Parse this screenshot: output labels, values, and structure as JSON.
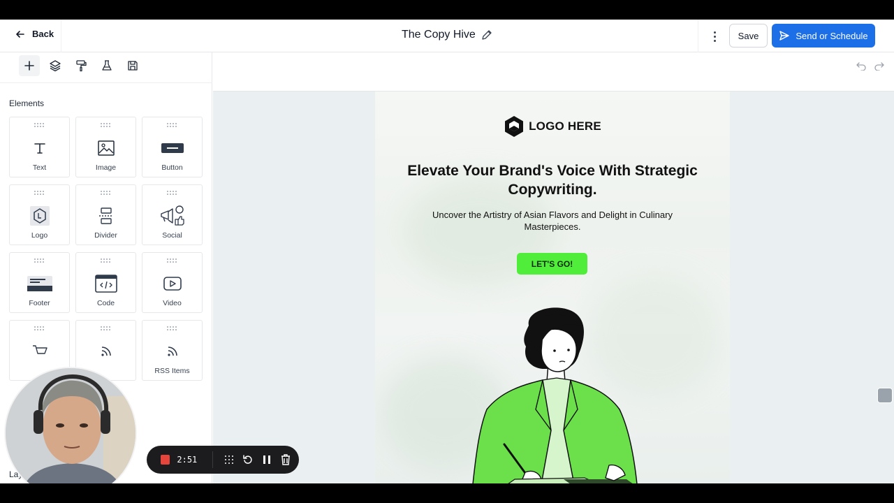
{
  "header": {
    "back_label": "Back",
    "title": "The Copy Hive",
    "save_label": "Save",
    "send_label": "Send or Schedule"
  },
  "sidebar": {
    "tools": [
      "plus-icon",
      "layers-icon",
      "paint-roller-icon",
      "flask-icon",
      "save-icon"
    ],
    "elements_label": "Elements",
    "elements": [
      {
        "label": "Text",
        "icon": "text-icon"
      },
      {
        "label": "Image",
        "icon": "image-icon"
      },
      {
        "label": "Button",
        "icon": "button-icon"
      },
      {
        "label": "Logo",
        "icon": "logo-icon"
      },
      {
        "label": "Divider",
        "icon": "divider-icon"
      },
      {
        "label": "Social",
        "icon": "social-icon"
      },
      {
        "label": "Footer",
        "icon": "footer-icon"
      },
      {
        "label": "Code",
        "icon": "code-icon"
      },
      {
        "label": "Video",
        "icon": "video-icon"
      },
      {
        "label": "",
        "icon": "cart-icon"
      },
      {
        "label": "",
        "icon": "rss-icon"
      },
      {
        "label": "RSS Items",
        "icon": "rss-icon"
      }
    ],
    "layouts_label": "Layouts"
  },
  "email": {
    "logo_text": "LOGO HERE",
    "headline": "Elevate Your Brand's Voice With Strategic Copywriting.",
    "subhead": "Uncover the Artistry of Asian Flavors and Delight in Culinary Masterpieces.",
    "cta_label": "LET'S GO!"
  },
  "recorder": {
    "time": "2:51"
  },
  "colors": {
    "primary": "#1d6fe8",
    "cta": "#50ee3a",
    "recording": "#e5453a"
  }
}
